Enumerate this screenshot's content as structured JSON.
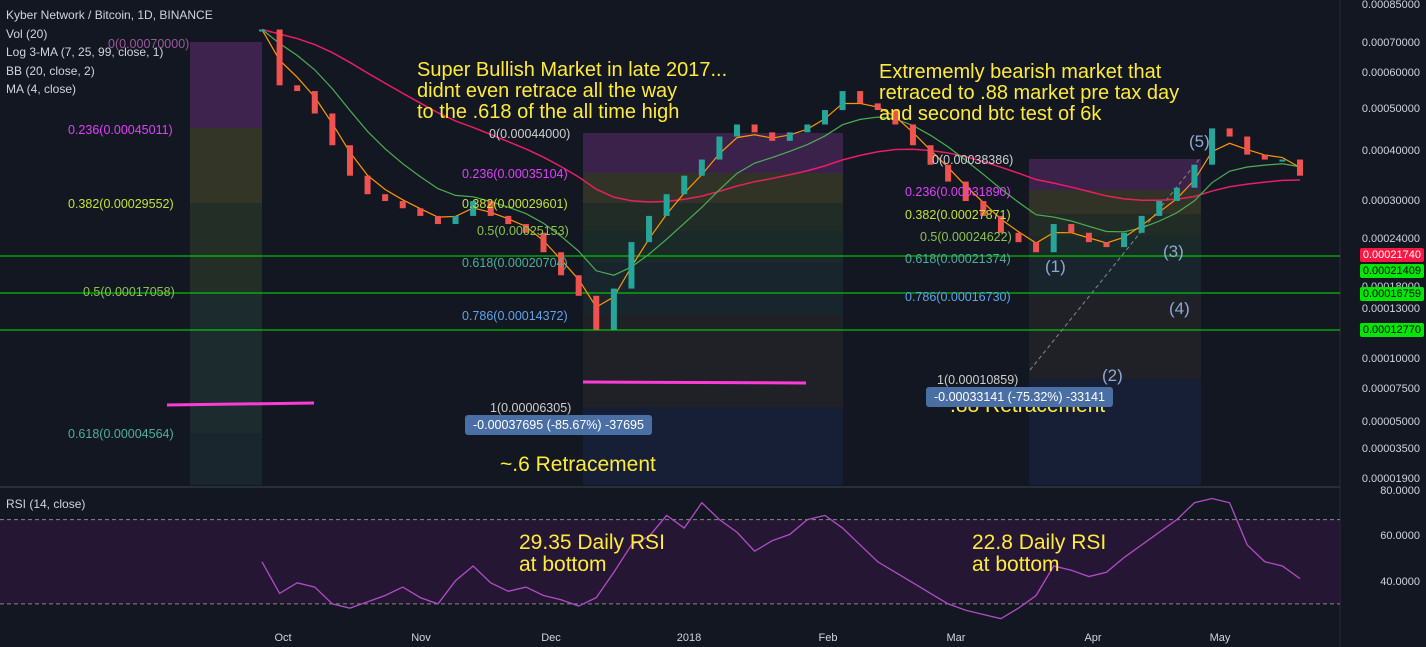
{
  "legend": {
    "title": "Kyber Network / Bitcoin, 1D, BINANCE",
    "vol": "Vol (20)",
    "ma": "Log 3-MA (7, 25, 99, close, 1)",
    "bb": "BB (20, close, 2)",
    "ma4": "MA (4, close)"
  },
  "rsi_legend": "RSI (14, close)",
  "annotations": {
    "bull": "Super Bullish Market in late 2017...\ndidnt even retrace all the way\nto the .618 of the all time high",
    "bear": "Extrememly bearish market that\nretraced to .88 market pre tax day\nand second btc test of 6k",
    "retr6": "~.6 Retracement",
    "retr88": ".88 Retracement",
    "rsi1": "29.35 Daily RSI\nat bottom",
    "rsi2": "22.8 Daily RSI\nat bottom"
  },
  "fib_left": {
    "l0": "0(0.00070000)",
    "l236": "0.236(0.00045011)",
    "l382": "0.382(0.00029552)",
    "l5": "0.5(0.00017058)",
    "l618": "0.618(0.00004564)"
  },
  "fib_mid": {
    "l0": "0(0.00044000)",
    "l236": "0.236(0.00035104)",
    "l382": "0.382(0.00029601)",
    "l5": "0.5(0.00025153)",
    "l618": "0.618(0.00020704)",
    "l786": "0.786(0.00014372)",
    "l1": "1(0.00006305)",
    "measure": "-0.00037695 (-85.67%) -37695"
  },
  "fib_right": {
    "l0": "0(0.00038386)",
    "l236": "0.236(0.00031890)",
    "l382": "0.382(0.00027871)",
    "l5": "0.5(0.00024622)",
    "l618": "0.618(0.00021374)",
    "l786": "0.786(0.00016730)",
    "l1": "1(0.00010859)",
    "measure": "-0.00033141 (-75.32%) -33141"
  },
  "waves": [
    "(1)",
    "(2)",
    "(3)",
    "(4)",
    "(5)"
  ],
  "y_axis_main": [
    "0.00085000",
    "0.00070000",
    "0.00060000",
    "0.00050000",
    "0.00040000",
    "0.00030000",
    "0.00024000",
    "0.00018000",
    "0.00013000",
    "0.00010000",
    "0.00007500",
    "0.00005000",
    "0.00003500",
    "0.00001900"
  ],
  "y_axis_rsi": [
    "80.0000",
    "60.0000",
    "40.0000"
  ],
  "price_tags": {
    "last": "0.00021740",
    "p1": "0.00021409",
    "p2": "0.00016759",
    "p3": "0.00012770"
  },
  "x_axis": [
    "Oct",
    "Nov",
    "Dec",
    "2018",
    "Feb",
    "Mar",
    "Apr",
    "May"
  ],
  "colors": {
    "bg": "#131722",
    "up": "#26a69a",
    "down": "#ef5350",
    "ma7": "#ff9800",
    "ma25": "#4caf50",
    "ma99": "#e91e63",
    "bb": "#7ecbe0",
    "rsi": "#9c27b0",
    "fib_pink": "#e040fb",
    "annotation": "#ffeb3b"
  },
  "chart_data": {
    "type": "line",
    "title": "Kyber Network / Bitcoin, 1D, BINANCE",
    "y_scale": "log",
    "ylim": [
      1.9e-05,
      0.00085
    ],
    "x": [
      "Sep 25",
      "Sep 28",
      "Oct 2",
      "Oct 6",
      "Oct 10",
      "Oct 14",
      "Oct 18",
      "Oct 22",
      "Oct 26",
      "Oct 30",
      "Nov 3",
      "Nov 7",
      "Nov 11",
      "Nov 15",
      "Nov 19",
      "Nov 23",
      "Nov 27",
      "Dec 1",
      "Dec 5",
      "Dec 8",
      "Dec 12",
      "Dec 16",
      "Dec 20",
      "Dec 24",
      "Dec 28",
      "Jan 1",
      "Jan 5",
      "Jan 9",
      "Jan 13",
      "Jan 17",
      "Jan 21",
      "Jan 25",
      "Jan 29",
      "Feb 2",
      "Feb 6",
      "Feb 10",
      "Feb 14",
      "Feb 18",
      "Feb 22",
      "Feb 26",
      "Mar 2",
      "Mar 6",
      "Mar 10",
      "Mar 14",
      "Mar 18",
      "Mar 22",
      "Mar 26",
      "Mar 30",
      "Apr 3",
      "Apr 7",
      "Apr 11",
      "Apr 15",
      "Apr 19",
      "Apr 23",
      "Apr 27",
      "May 1",
      "May 5",
      "May 9",
      "May 13",
      "May 17"
    ],
    "series": [
      {
        "values": [
          0.0007,
          0.00045,
          0.00043,
          0.00036,
          0.00028,
          0.00022,
          0.00019,
          0.00018,
          0.00017,
          0.00016,
          0.00015,
          0.00016,
          0.00018,
          0.00016,
          0.00015,
          0.00014,
          0.00012,
          0.0001,
          8.5e-05,
          6.5e-05,
          9e-05,
          0.00013,
          0.00016,
          0.00019,
          0.00022,
          0.00025,
          0.0003,
          0.00033,
          0.00031,
          0.00029,
          0.00031,
          0.00033,
          0.00037,
          0.00043,
          0.00039,
          0.00037,
          0.00033,
          0.00028,
          0.00024,
          0.00021,
          0.00018,
          0.00016,
          0.00014,
          0.00013,
          0.00012,
          0.00015,
          0.00014,
          0.00013,
          0.000125,
          0.00014,
          0.00016,
          0.00018,
          0.0002,
          0.00024,
          0.00032,
          0.0003,
          0.00026,
          0.00025,
          0.00025,
          0.00022
        ]
      }
    ],
    "rsi": {
      "ylim": [
        20,
        85
      ],
      "bands": [
        70,
        30
      ],
      "values": [
        50,
        35,
        40,
        38,
        30,
        28,
        31,
        34,
        38,
        33,
        30,
        41,
        48,
        40,
        36,
        38,
        34,
        32,
        29,
        33,
        45,
        58,
        62,
        72,
        66,
        78,
        70,
        64,
        55,
        60,
        63,
        70,
        72,
        66,
        58,
        50,
        45,
        40,
        35,
        30,
        27,
        25,
        23,
        28,
        34,
        48,
        46,
        43,
        45,
        52,
        58,
        64,
        70,
        78,
        80,
        78,
        58,
        50,
        48,
        42
      ]
    }
  }
}
